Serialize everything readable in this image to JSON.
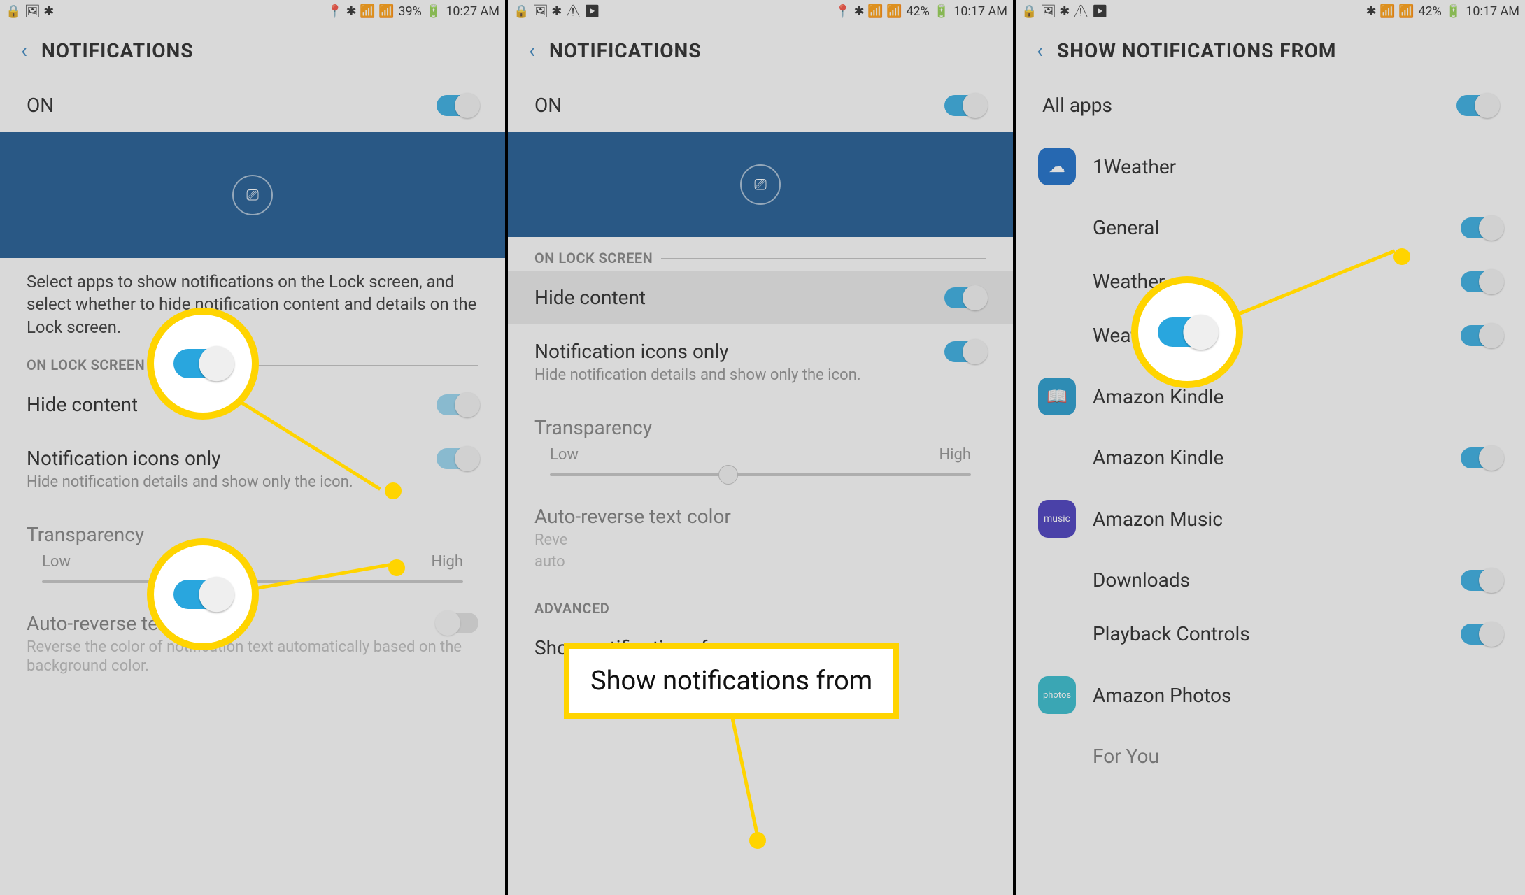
{
  "phone1": {
    "status": {
      "left_icons": "🔒 🖼 ✱",
      "right_icons": "📍 ✱ 📶 📶",
      "battery": "39%",
      "time": "10:27 AM"
    },
    "header_title": "NOTIFICATIONS",
    "on_label": "ON",
    "desc": "Select apps to show notifications on the Lock screen, and select whether to hide notification content and details on the Lock screen.",
    "section_lock": "ON LOCK SCREEN",
    "hide_content": "Hide content",
    "icons_only": "Notification icons only",
    "icons_only_sub": "Hide notification details and show only the icon.",
    "transparency": "Transparency",
    "low": "Low",
    "high": "High",
    "auto_reverse": "Auto-reverse text color",
    "auto_reverse_sub": "Reverse the color of notification text automatically based on the background color."
  },
  "phone2": {
    "status": {
      "left_icons": "🔒 🖼 ✱ ⚠ ▶",
      "right_icons": "📍 ✱ 📶 📶",
      "battery": "42%",
      "time": "10:17 AM"
    },
    "header_title": "NOTIFICATIONS",
    "on_label": "ON",
    "section_lock": "ON LOCK SCREEN",
    "hide_content": "Hide content",
    "icons_only": "Notification icons only",
    "icons_only_sub": "Hide notification details and show only the icon.",
    "transparency": "Transparency",
    "low": "Low",
    "high": "High",
    "auto_reverse": "Auto-reverse text color",
    "auto_reverse_sub1": "Reve",
    "auto_reverse_sub2": "auto",
    "section_adv": "ADVANCED",
    "show_from": "Show notifications from",
    "callout_label": "Show notifications from"
  },
  "phone3": {
    "status": {
      "left_icons": "🔒 🖼  ✱ ⚠ ▶",
      "right_icons": "✱ 📶 📶",
      "battery": "42%",
      "time": "10:17 AM"
    },
    "header_title": "SHOW NOTIFICATIONS FROM",
    "all_apps": "All apps",
    "apps": [
      {
        "name": "1Weather",
        "icon_bg": "#0b63c4",
        "icon": "☁"
      },
      {
        "sub": "General"
      },
      {
        "sub": "Weather"
      },
      {
        "sub": "Weather Tips"
      },
      {
        "name": "Amazon Kindle",
        "icon_bg": "#1693c9",
        "icon": "📖"
      },
      {
        "sub": "Amazon Kindle"
      },
      {
        "name": "Amazon Music",
        "icon_bg": "#3b2fb8",
        "icon": "music"
      },
      {
        "sub": "Downloads"
      },
      {
        "sub": "Playback Controls"
      },
      {
        "name": "Amazon Photos",
        "icon_bg": "#26b6c9",
        "icon": "photos"
      },
      {
        "sub": "For You"
      }
    ]
  }
}
